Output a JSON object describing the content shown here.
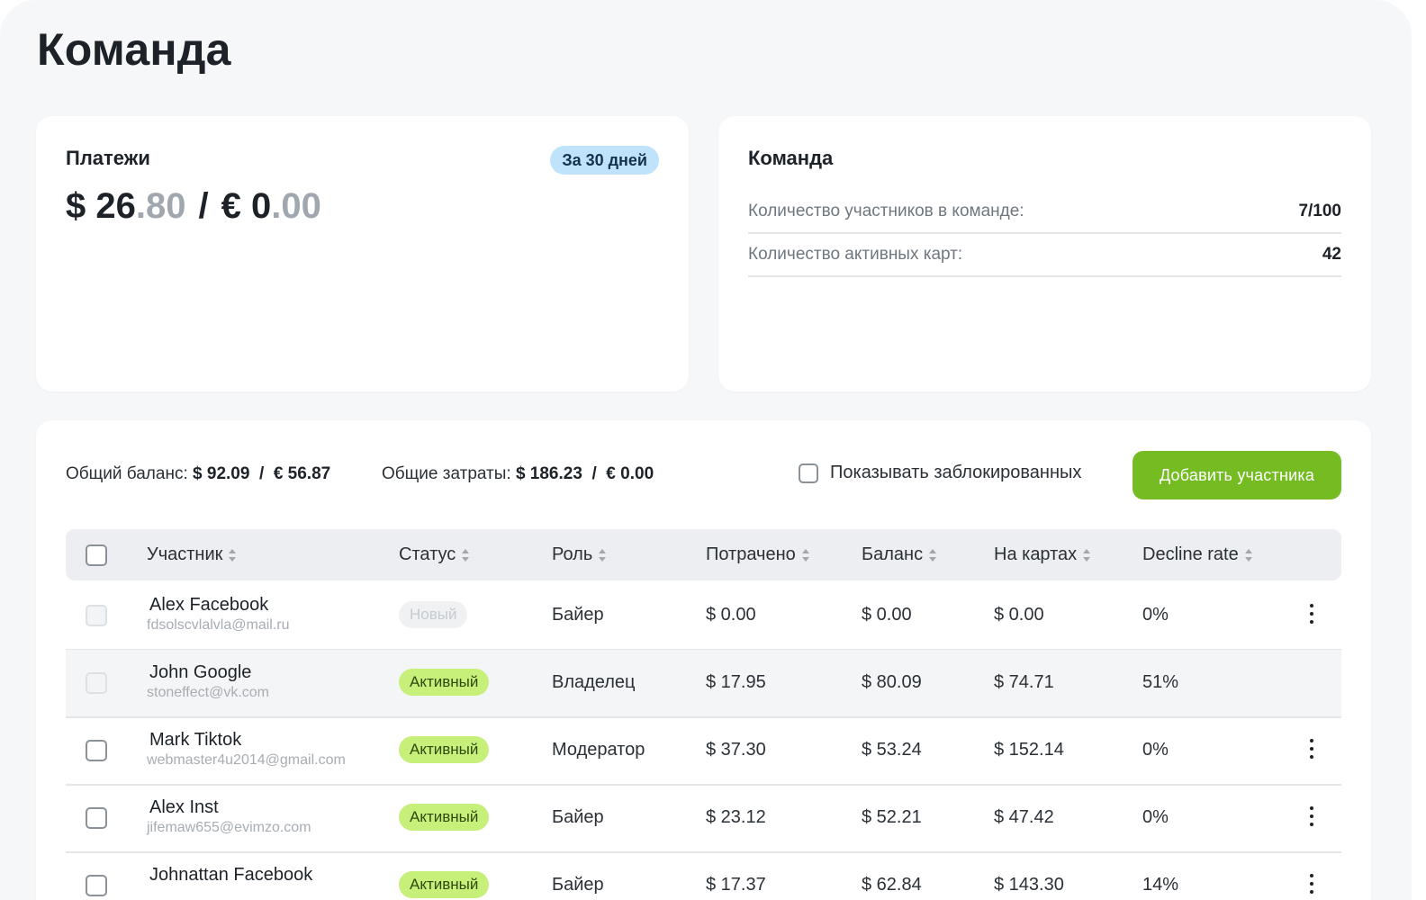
{
  "page": {
    "title": "Команда"
  },
  "payments": {
    "title": "Платежи",
    "period": "За 30 дней",
    "usd_int": "$ 26",
    "usd_dec": ".80",
    "separator": "/",
    "eur_int": "€ 0",
    "eur_dec": ".00"
  },
  "team_stats": {
    "title": "Команда",
    "rows": [
      {
        "label": "Количество участников в команде:",
        "value": "7/100"
      },
      {
        "label": "Количество активных карт:",
        "value": "42"
      }
    ]
  },
  "summary": {
    "balance_label": "Общий баланс:",
    "balance_value": "$ 92.09  /  € 56.87",
    "spend_label": "Общие затраты:",
    "spend_value": "$ 186.23  /  € 0.00",
    "show_blocked_label": "Показывать заблокированных",
    "add_button": "Добавить участника"
  },
  "table": {
    "columns": [
      "Участник",
      "Статус",
      "Роль",
      "Потрачено",
      "Баланс",
      "На картах",
      "Decline rate"
    ],
    "rows": [
      {
        "name": "Alex Facebook",
        "email": "fdsolscvlalvla@mail.ru",
        "status": "Новый",
        "status_type": "new",
        "role": "Байер",
        "spent": "$ 0.00",
        "balance": "$ 0.00",
        "on_cards": "$ 0.00",
        "decline": "0%",
        "menu": true,
        "checkbox_muted": true
      },
      {
        "name": "John Google",
        "email": "stoneffect@vk.com",
        "status": "Активный",
        "status_type": "active",
        "role": "Владелец",
        "spent": "$ 17.95",
        "balance": "$ 80.09",
        "on_cards": "$ 74.71",
        "decline": "51%",
        "menu": false,
        "checkbox_muted": true
      },
      {
        "name": "Mark Tiktok",
        "email": "webmaster4u2014@gmail.com",
        "status": "Активный",
        "status_type": "active",
        "role": "Модератор",
        "spent": "$ 37.30",
        "balance": "$ 53.24",
        "on_cards": "$ 152.14",
        "decline": "0%",
        "menu": true,
        "checkbox_muted": false
      },
      {
        "name": "Alex Inst",
        "email": "jifemaw655@evimzo.com",
        "status": "Активный",
        "status_type": "active",
        "role": "Байер",
        "spent": "$ 23.12",
        "balance": "$ 52.21",
        "on_cards": "$ 47.42",
        "decline": "0%",
        "menu": true,
        "checkbox_muted": false
      },
      {
        "name": "Johnattan Facebook",
        "email": "",
        "status": "Активный",
        "status_type": "active",
        "role": "Байер",
        "spent": "$ 17.37",
        "balance": "$ 62.84",
        "on_cards": "$ 143.30",
        "decline": "14%",
        "menu": true,
        "checkbox_muted": false
      }
    ]
  }
}
